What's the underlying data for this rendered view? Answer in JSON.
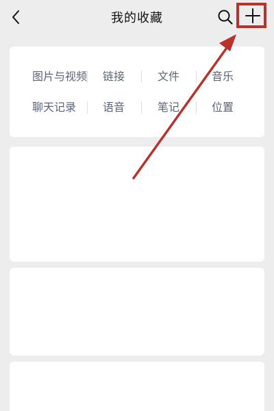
{
  "header": {
    "title": "我的收藏",
    "back_icon": "chevron-left-icon",
    "search_icon": "search-icon",
    "add_icon": "plus-icon"
  },
  "categories": {
    "row1": [
      "图片与视频",
      "链接",
      "文件",
      "音乐"
    ],
    "row2": [
      "聊天记录",
      "语音",
      "笔记",
      "位置"
    ]
  },
  "colors": {
    "background": "#ededed",
    "card": "#ffffff",
    "category_text": "#5a6478",
    "annotation_red": "#b8312a"
  }
}
